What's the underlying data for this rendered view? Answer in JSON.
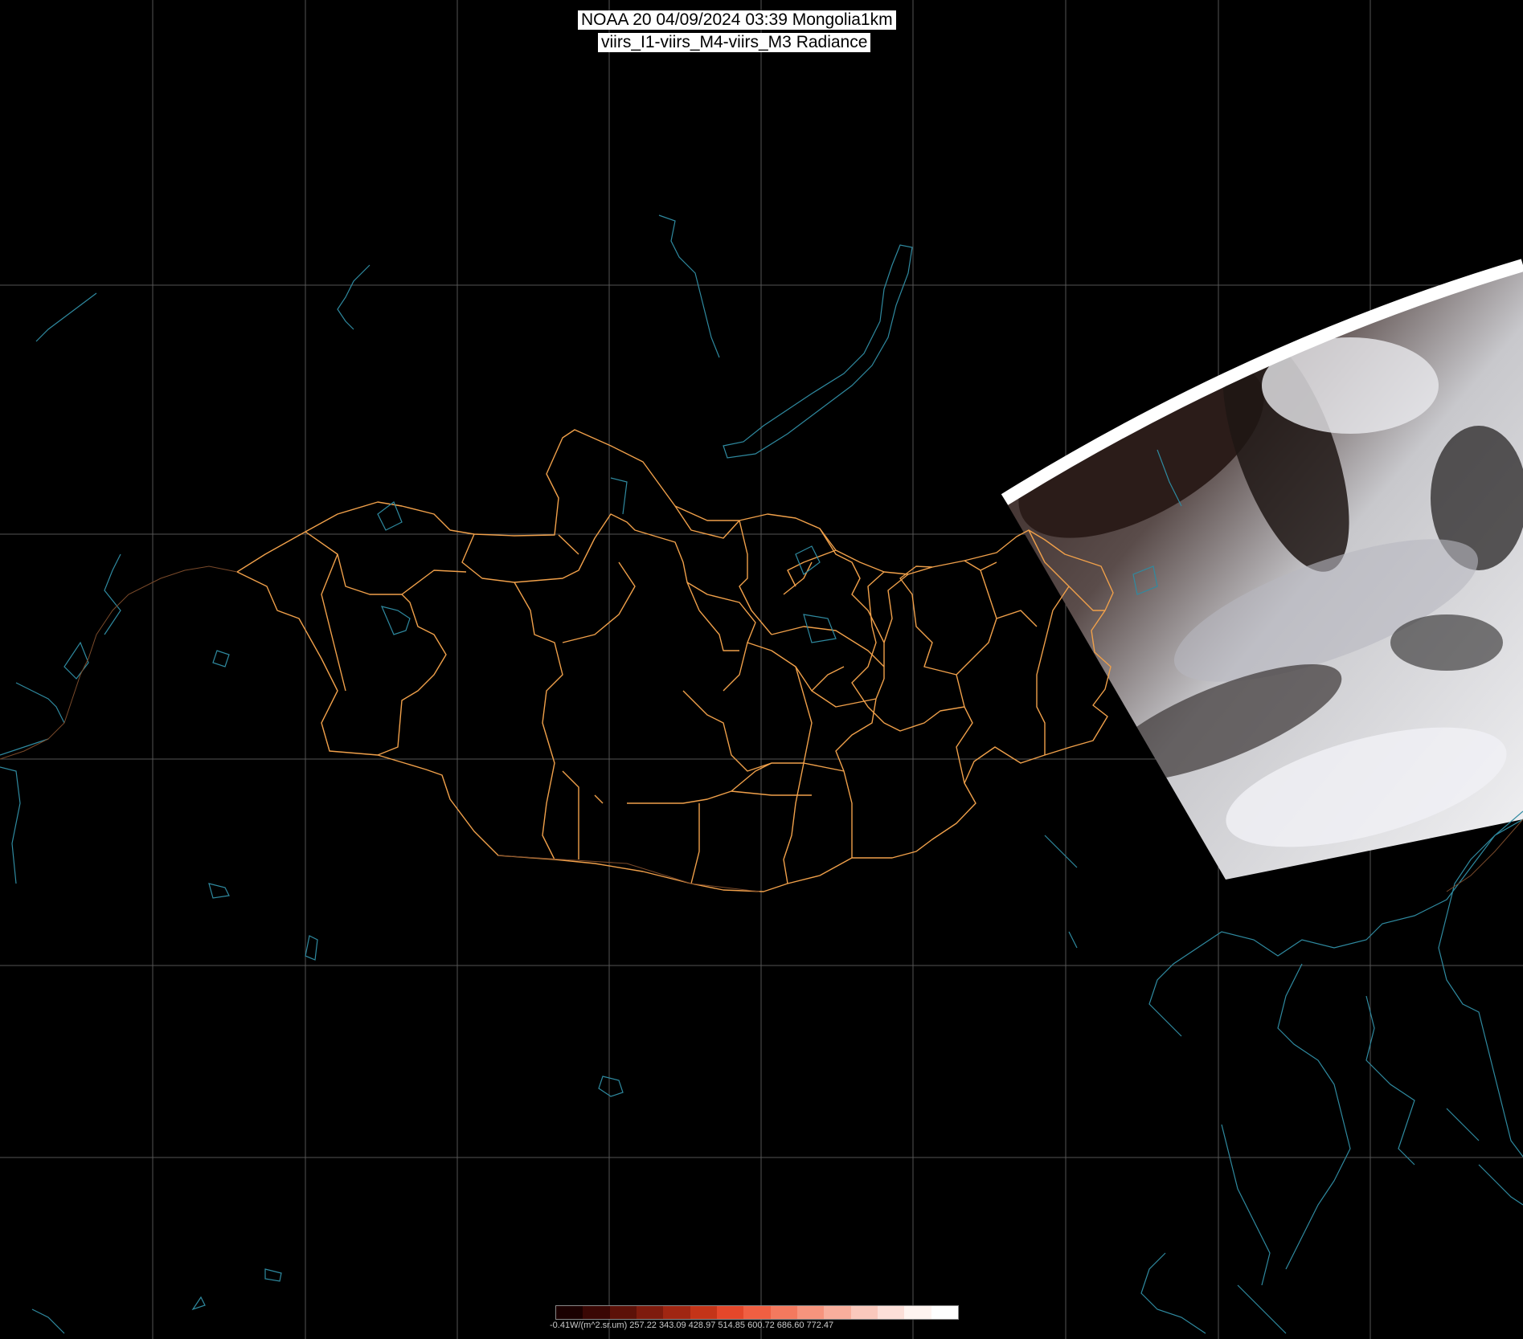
{
  "title": {
    "line1": "NOAA 20 04/09/2024 03:39 Mongolia1km",
    "line2": "viirs_I1-viirs_M4-viirs_M3 Radiance"
  },
  "legend": {
    "ticks": "-0.41W/(m^2.sr.um)   257.22   343.09   428.97   514.85   600.72   686.60   772.47",
    "colors": [
      "#1a0000",
      "#3a0704",
      "#5c1108",
      "#7e1b0d",
      "#a02612",
      "#c43418",
      "#e4472a",
      "#f05f42",
      "#f4795e",
      "#f6947d",
      "#f8ae9c",
      "#fac8bc",
      "#fcdfd8",
      "#fff4f0",
      "#ffffff"
    ]
  },
  "colors": {
    "background": "#000000",
    "grid": "#555555",
    "border": "#f0a04a",
    "coast": "#2f8aa0"
  },
  "features": [
    "graticule-grid",
    "mongolia-province-borders",
    "lake-baikal",
    "coastlines",
    "satellite-swath"
  ]
}
